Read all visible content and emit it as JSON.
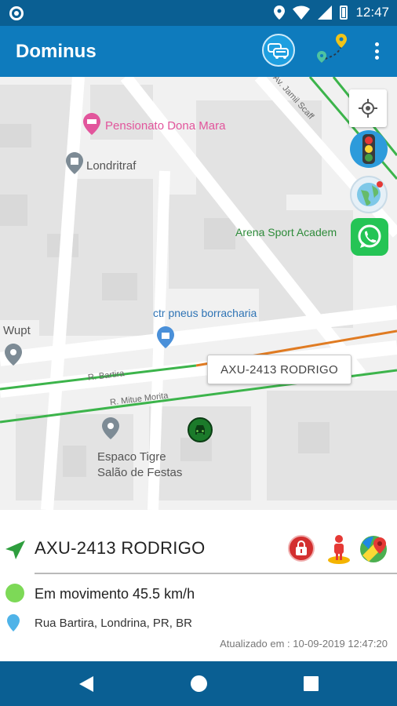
{
  "status_bar": {
    "time": "12:47",
    "icons": [
      "location-icon",
      "wifi-icon",
      "signal-icon",
      "battery-icon"
    ]
  },
  "app_bar": {
    "title": "Dominus",
    "actions": [
      "fleet-icon",
      "route-icon",
      "more-vert-icon"
    ]
  },
  "map": {
    "pois": [
      {
        "label": "Pensionato Dona Mara",
        "color": "#e2559c"
      },
      {
        "label": "Londritraf",
        "color": "#555555"
      },
      {
        "label": "Arena Sport Academ",
        "color": "#2e8b3a"
      },
      {
        "label": "ctr pneus borracharia",
        "color": "#2f74b5"
      },
      {
        "label": "Wupt",
        "color": "#555555"
      },
      {
        "label": "Espaco Tigre",
        "color": "#555555"
      },
      {
        "label": "Salão de Festas",
        "color": "#555555"
      }
    ],
    "streets": [
      "R. Bartira",
      "R. Mitue Morita",
      "Av. Jamil Scaff"
    ],
    "vehicle_callout": "AXU-2413 RODRIGO",
    "route_colors": {
      "green": "#3cb44b",
      "orange": "#e07b22"
    },
    "buttons": [
      "my-location-icon",
      "traffic-light-icon",
      "globe-icon",
      "whatsapp-icon"
    ]
  },
  "panel": {
    "vehicle_name": "AXU-2413 RODRIGO",
    "status": "Em movimento 45.5 km/h",
    "status_color": "#7dd957",
    "address": "Rua Bartira, Londrina, PR, BR",
    "updated": "Atualizado em : 10-09-2019 12:47:20",
    "actions": [
      "lock-icon",
      "street-view-icon",
      "google-maps-icon"
    ]
  },
  "nav_bar": {
    "buttons": [
      "back-icon",
      "home-icon",
      "recents-icon"
    ]
  }
}
